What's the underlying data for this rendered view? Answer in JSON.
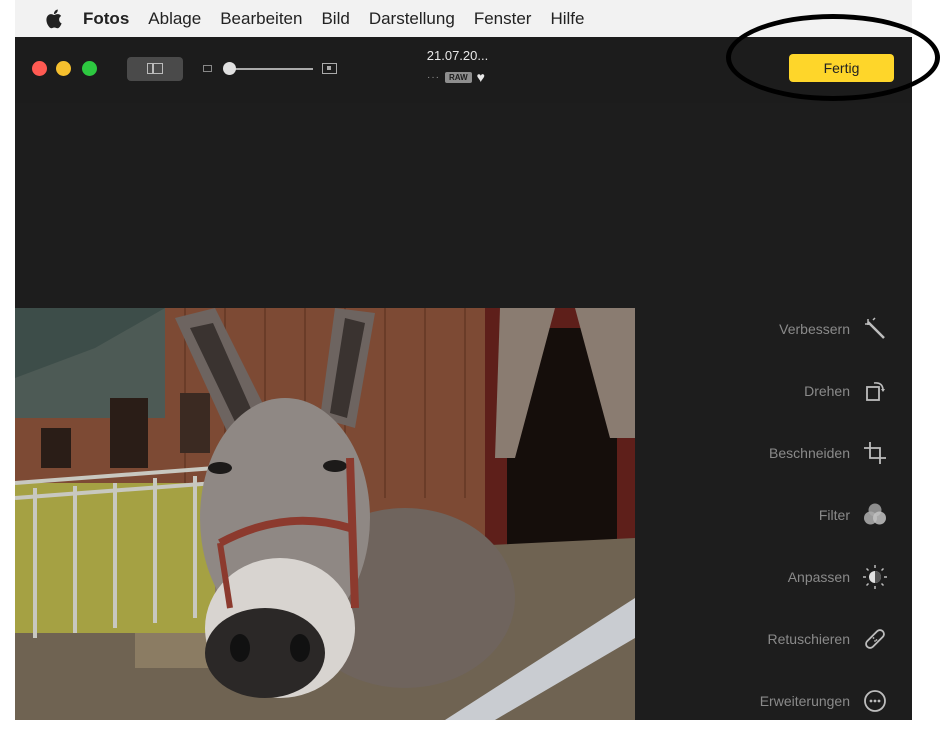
{
  "menubar": {
    "apple_icon": "apple-icon",
    "items": [
      "Fotos",
      "Ablage",
      "Bearbeiten",
      "Bild",
      "Darstellung",
      "Fenster",
      "Hilfe"
    ]
  },
  "toolbar": {
    "photo_title": "21.07.20...",
    "photo_meta_dots": "···",
    "raw_badge": "RAW",
    "favorite_icon": "heart-icon",
    "done_label": "Fertig",
    "zoom_level": 0.0
  },
  "colors": {
    "accent_done": "#fed62a",
    "window_bg": "#1d1d1d",
    "close": "#ff5a52",
    "minimize": "#f5bf2e",
    "zoom": "#2dc840"
  },
  "tools": [
    {
      "label": "Verbessern",
      "icon": "magic-wand-icon"
    },
    {
      "label": "Drehen",
      "icon": "rotate-icon"
    },
    {
      "label": "Beschneiden",
      "icon": "crop-icon"
    },
    {
      "label": "Filter",
      "icon": "filter-icon"
    },
    {
      "label": "Anpassen",
      "icon": "adjust-icon"
    },
    {
      "label": "Retuschieren",
      "icon": "bandage-icon"
    },
    {
      "label": "Erweiterungen",
      "icon": "more-icon"
    }
  ]
}
